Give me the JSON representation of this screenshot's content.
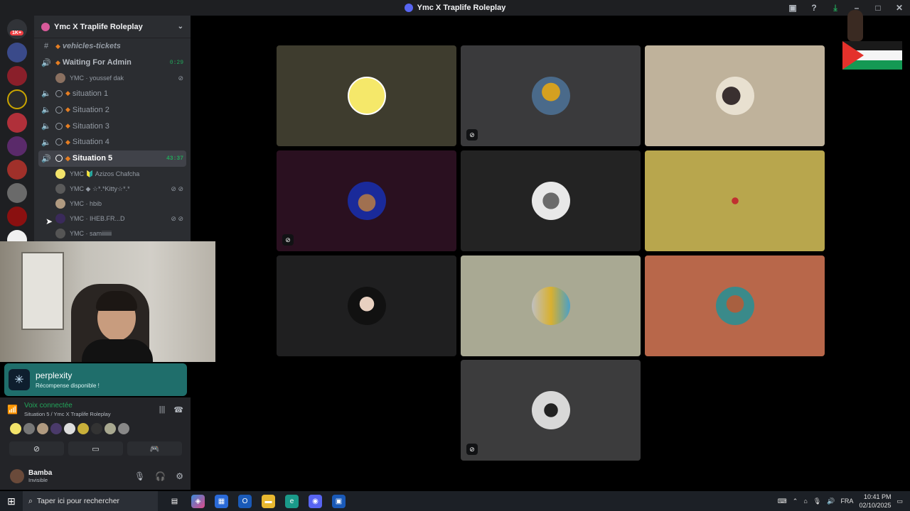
{
  "window": {
    "title": "Ymc X Traplife Roleplay"
  },
  "guilds": {
    "badge": "1K+"
  },
  "server": {
    "name": "Ymc X Traplife Roleplay"
  },
  "channels": [
    {
      "name": "vehicles-tickets",
      "type": "text"
    },
    {
      "name": "Waiting For Admin",
      "type": "voice",
      "time": "0:29"
    },
    {
      "name": "situation 1",
      "type": "voice"
    },
    {
      "name": "Situation 2",
      "type": "voice"
    },
    {
      "name": "Situation 3",
      "type": "voice"
    },
    {
      "name": "Situation 4",
      "type": "voice"
    },
    {
      "name": "Situation 5",
      "type": "voice",
      "time": "43:37",
      "active": true
    }
  ],
  "voice_users": {
    "waiting": "YMC · youssef dak",
    "s5": [
      "YMC 🔰 Azizos Chafcha",
      "YMC ◆ ☆*.*Kitty☆*.*",
      "YMC · hbib",
      "YMC · IHEB.FR...D",
      "YMC · samiiiiiii"
    ]
  },
  "notification": {
    "title": "perplexity",
    "subtitle": "Récompense disponible !"
  },
  "voice_connection": {
    "status": "Voix connectée",
    "channel": "Situation 5 / Ymc X Traplife Roleplay"
  },
  "user": {
    "name": "Bamba",
    "status": "Invisible"
  },
  "taskbar": {
    "search_placeholder": "Taper ici pour rechercher",
    "lang": "FRA",
    "time": "10:41 PM",
    "date": "02/10/2025"
  },
  "colors": {
    "accent": "#5865f2",
    "connected": "#23a55a",
    "notif": "#1f6e6b"
  }
}
